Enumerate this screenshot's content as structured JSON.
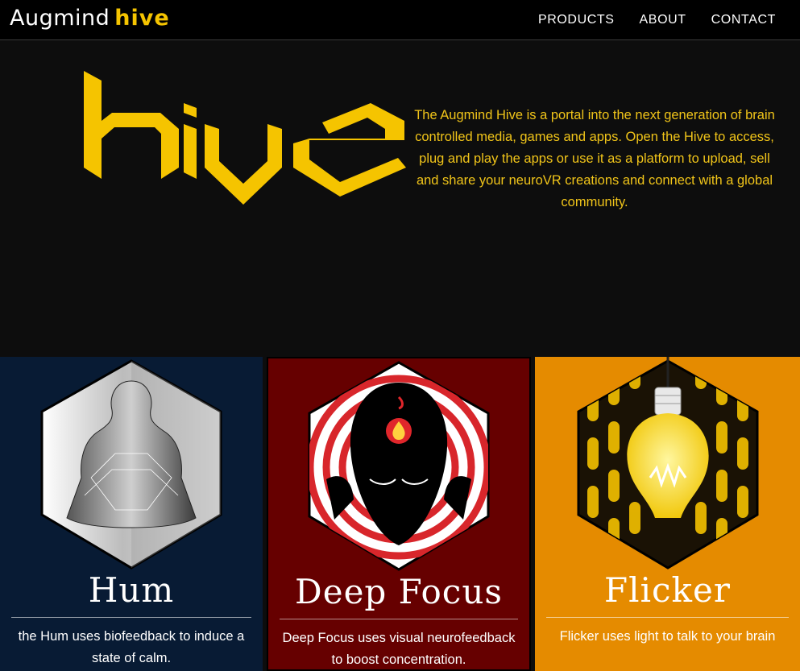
{
  "nav": {
    "brand_main": "Augmind",
    "brand_accent": "hive",
    "items": [
      "PRODUCTS",
      "ABOUT",
      "CONTACT"
    ]
  },
  "hero": {
    "logo_word": "hive",
    "description": "The Augmind Hive is a portal into the next generation of brain controlled media, games and apps. Open the Hive to access, plug and play the apps or use it as a platform to upload, sell and share your neuroVR creations and connect with a global community."
  },
  "cards": [
    {
      "title": "Hum",
      "description": "the Hum uses biofeedback to induce a state of calm."
    },
    {
      "title": "Deep Focus",
      "description": "Deep Focus uses visual neurofeedback to boost concentration."
    },
    {
      "title": "Flicker",
      "description": "Flicker uses light to talk to your brain"
    }
  ],
  "colors": {
    "accent": "#f5c400",
    "hero_text": "#f0c419",
    "nav_bg": "#000000",
    "page_bg": "#0d0d0d",
    "hum_bg": "#081b34",
    "deep_bg": "#660000",
    "flicker_bg": "#e58b00"
  }
}
